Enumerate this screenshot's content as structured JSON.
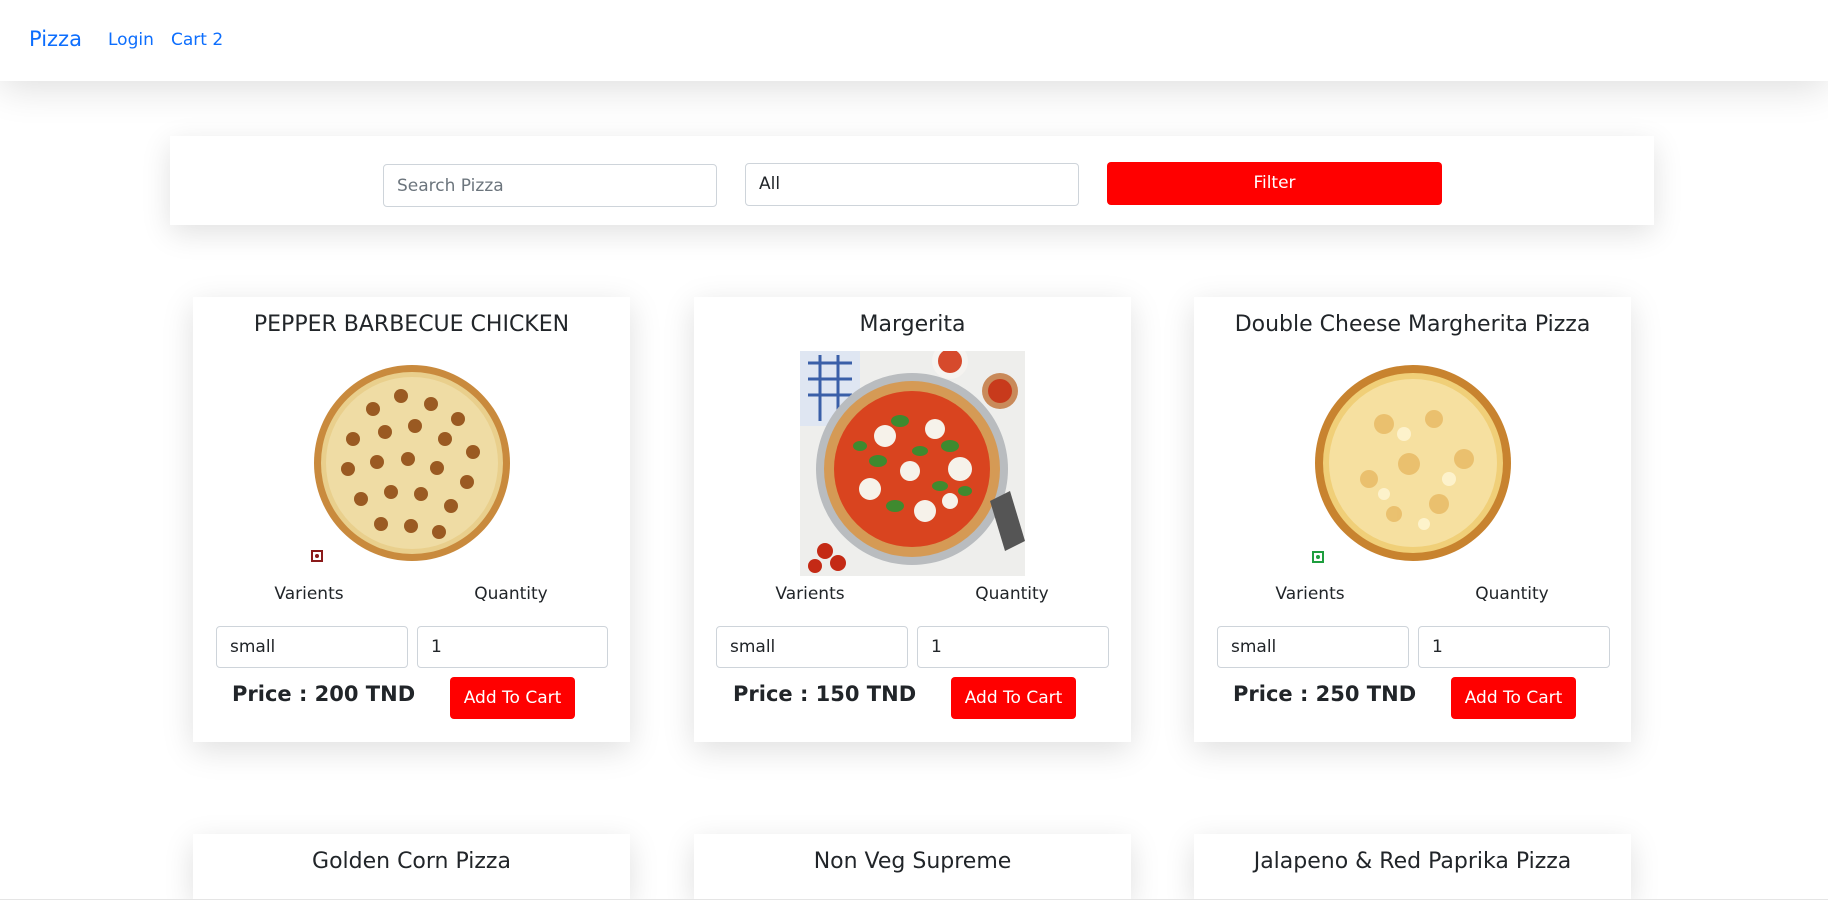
{
  "nav": {
    "brand": "Pizza",
    "links": [
      "Login",
      "Cart 2"
    ]
  },
  "filter": {
    "search_placeholder": "Search Pizza",
    "category_value": "All",
    "button_label": "Filter"
  },
  "labels": {
    "varients": "Varients",
    "quantity": "Quantity",
    "add_to_cart": "Add To Cart"
  },
  "pizzas": [
    {
      "name": "PEPPER BARBECUE CHICKEN",
      "varient": "small",
      "quantity": "1",
      "price": "Price : 200 TND",
      "diet": "non-veg"
    },
    {
      "name": "Margerita",
      "varient": "small",
      "quantity": "1",
      "price": "Price : 150 TND",
      "diet": "none"
    },
    {
      "name": "Double Cheese Margherita Pizza",
      "varient": "small",
      "quantity": "1",
      "price": "Price : 250 TND",
      "diet": "veg"
    },
    {
      "name": "Golden Corn Pizza"
    },
    {
      "name": "Non Veg Supreme"
    },
    {
      "name": "Jalapeno & Red Paprika Pizza"
    }
  ],
  "colors": {
    "accent": "#ff0000",
    "link": "#0d6efd",
    "nonveg_mark": "#8b1a1a",
    "veg_mark": "#1e9e3e"
  }
}
